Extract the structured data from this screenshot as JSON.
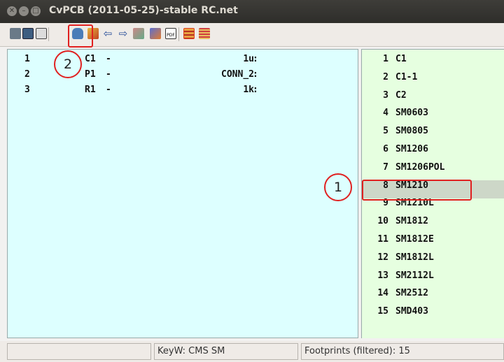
{
  "window": {
    "title": "CvPCB (2011-05-25)-stable RC.net"
  },
  "toolbar": {
    "icons": [
      "open-netlist-icon",
      "save-icon",
      "configure-icon",
      "view-footprint-icon",
      "auto-associate-icon",
      "previous-icon",
      "next-icon",
      "delete-associations-icon",
      "footprint-doc-icon",
      "pdf-doc-icon",
      "filter-keyword-icon",
      "filter-pincount-icon"
    ]
  },
  "components": [
    {
      "index": "1",
      "ref": "C1",
      "dash": "-",
      "value": "1u",
      "colon": ":"
    },
    {
      "index": "2",
      "ref": "P1",
      "dash": "-",
      "value": "CONN_2",
      "colon": ":"
    },
    {
      "index": "3",
      "ref": "R1",
      "dash": "-",
      "value": "1k",
      "colon": ":"
    }
  ],
  "footprints": [
    {
      "num": "1",
      "name": "C1"
    },
    {
      "num": "2",
      "name": "C1-1"
    },
    {
      "num": "3",
      "name": "C2"
    },
    {
      "num": "4",
      "name": "SM0603"
    },
    {
      "num": "5",
      "name": "SM0805"
    },
    {
      "num": "6",
      "name": "SM1206"
    },
    {
      "num": "7",
      "name": "SM1206POL"
    },
    {
      "num": "8",
      "name": "SM1210"
    },
    {
      "num": "9",
      "name": "SM1210L"
    },
    {
      "num": "10",
      "name": "SM1812"
    },
    {
      "num": "11",
      "name": "SM1812E"
    },
    {
      "num": "12",
      "name": "SM1812L"
    },
    {
      "num": "13",
      "name": "SM2112L"
    },
    {
      "num": "14",
      "name": "SM2512"
    },
    {
      "num": "15",
      "name": "SMD403"
    }
  ],
  "selected_footprint": "8",
  "annotations": {
    "circle1": "1",
    "circle2": "2"
  },
  "status": {
    "left": "",
    "keyword": "KeyW: CMS SM",
    "footprints": "Footprints (filtered): 15"
  },
  "colors": {
    "highlight": "#e02020",
    "components_bg": "#ddffff",
    "footprints_bg": "#e6ffe0"
  }
}
